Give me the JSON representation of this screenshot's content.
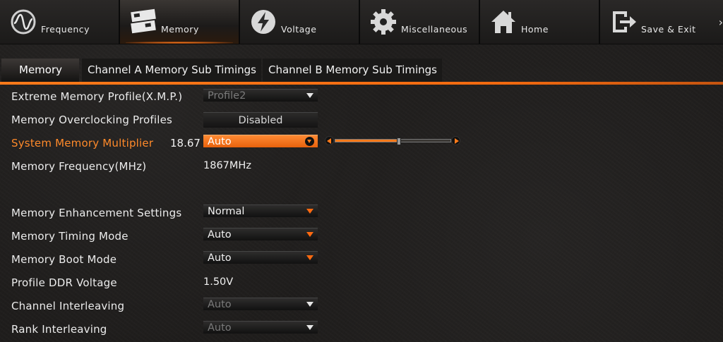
{
  "topnav": {
    "items": [
      {
        "label": "Frequency",
        "icon": "frequency-dial-icon"
      },
      {
        "label": "Memory",
        "icon": "memory-module-icon",
        "active": true
      },
      {
        "label": "Voltage",
        "icon": "lightning-icon"
      },
      {
        "label": "Miscellaneous",
        "icon": "gear-icon"
      },
      {
        "label": "Home",
        "icon": "home-icon"
      },
      {
        "label": "Save & Exit",
        "icon": "exit-icon"
      }
    ],
    "more_arrow": "›"
  },
  "subtabs": [
    {
      "label": "Memory",
      "active": true
    },
    {
      "label": "Channel A Memory Sub Timings"
    },
    {
      "label": "Channel B Memory Sub Timings"
    }
  ],
  "settings": {
    "xmp": {
      "label": "Extreme Memory Profile(X.M.P.)",
      "value": "Profile2"
    },
    "oc_profiles": {
      "label": "Memory Overclocking Profiles",
      "value": "Disabled"
    },
    "multiplier": {
      "label": "System Memory Multiplier",
      "ratio": "18.67",
      "value": "Auto",
      "slider_fraction": 0.55
    },
    "frequency": {
      "label": "Memory Frequency(MHz)",
      "value": "1867MHz"
    },
    "enhancement": {
      "label": "Memory Enhancement Settings",
      "value": "Normal"
    },
    "timing_mode": {
      "label": "Memory Timing Mode",
      "value": "Auto"
    },
    "boot_mode": {
      "label": "Memory Boot Mode",
      "value": "Auto"
    },
    "ddr_voltage": {
      "label": "Profile DDR Voltage",
      "value": "1.50V"
    },
    "channel_interleaving": {
      "label": "Channel Interleaving",
      "value": "Auto"
    },
    "rank_interleaving": {
      "label": "Rank Interleaving",
      "value": "Auto"
    }
  },
  "colors": {
    "accent": "#ff7a1a",
    "highlight_label": "#ff8a2a"
  }
}
